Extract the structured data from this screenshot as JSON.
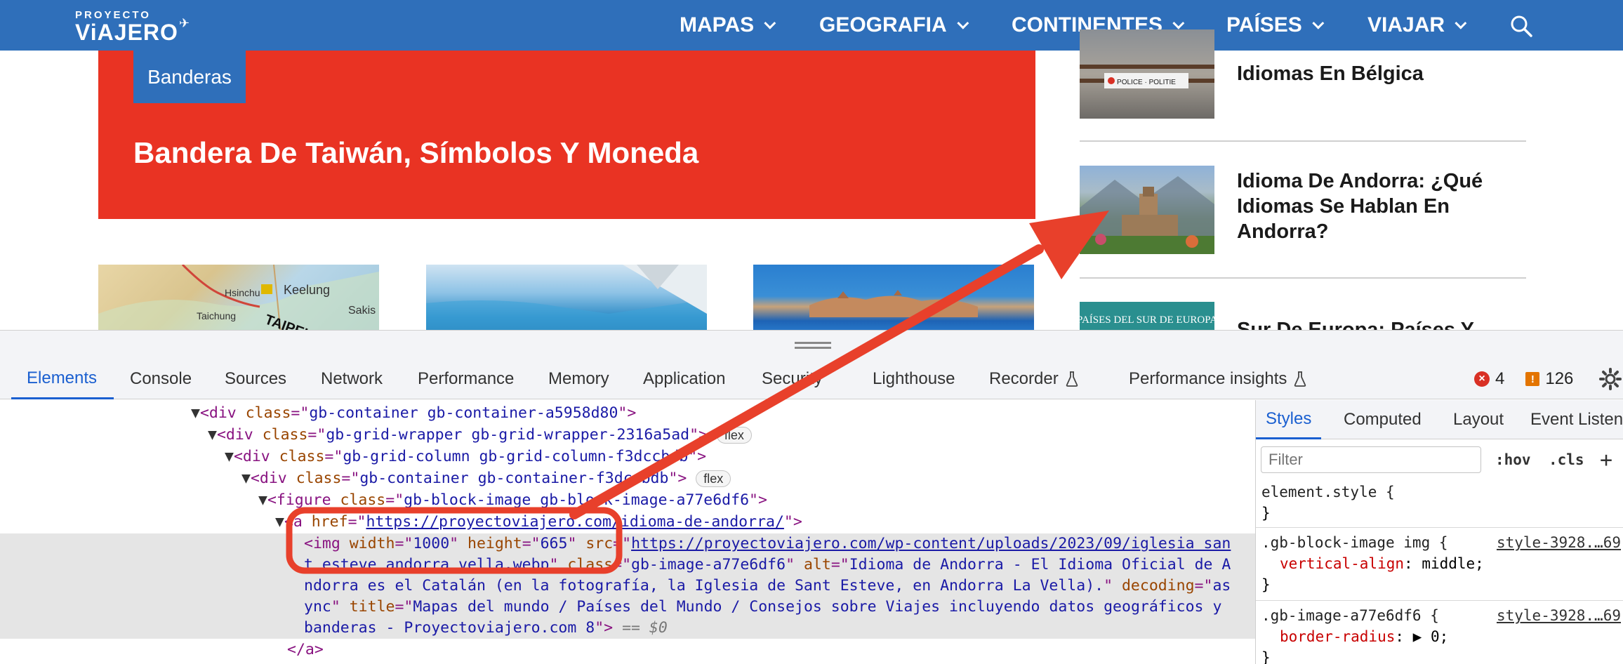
{
  "site": {
    "logo_line1": "PROYECTO",
    "logo_line2": "ViAJERO",
    "nav": [
      "MAPAS",
      "GEOGRAFIA",
      "CONTINENTES",
      "PAÍSES",
      "VIAJAR"
    ],
    "hero_badge": "Banderas",
    "hero_title": "Bandera De Taiwán, Símbolos Y Moneda",
    "thumb_map_text": [
      "Keelung",
      "TAIPEI",
      "Hsinchu",
      "Taichung",
      "Sakis"
    ],
    "sidebar": [
      {
        "title": "Idiomas En Bélgica",
        "img_text": "POLICE · POLITIE"
      },
      {
        "title": "Idioma De Andorra: ¿Qué Idiomas Se Hablan En Andorra?"
      },
      {
        "title": "Sur De Europa: Países Y",
        "img_text": "PAÍSES DEL SUR DE EUROPA"
      }
    ]
  },
  "devtools": {
    "tabs": [
      "Elements",
      "Console",
      "Sources",
      "Network",
      "Performance",
      "Memory",
      "Application",
      "Security",
      "Lighthouse",
      "Recorder",
      "Performance insights"
    ],
    "active_tab": "Elements",
    "error_count": "4",
    "warning_count": "126",
    "dom": {
      "l1_class": "gb-container gb-container-a5958d80",
      "l2_class": "gb-grid-wrapper gb-grid-wrapper-2316a5ad",
      "l2_badge": "flex",
      "l3_class": "gb-grid-column gb-grid-column-f3dccbdb",
      "l4_class": "gb-container gb-container-f3dccbdb",
      "l4_badge": "flex",
      "l5_class": "gb-block-image gb-block-image-a77e6df6",
      "l6_href": "https://proyectoviajero.com/idioma-de-andorra/",
      "img_width": "1000",
      "img_height": "665",
      "img_src": "https://proyectoviajero.com/wp-content/uploads/2023/09/iglesia san",
      "img_src_cont": "t esteve andorra vella.webp",
      "img_class": "gb-image-a77e6df6",
      "img_alt_1": "Idioma de Andorra - El Idioma Oficial de A",
      "img_alt_2": "ndorra es el Catalán (en la fotografía, la Iglesia de Sant Esteve, en Andorra La Vella).",
      "img_decoding_1": "as",
      "img_decoding_2": "ync",
      "img_title_1": "Mapas del mundo / Países del Mundo / Consejos sobre Viajes incluyendo datos geográficos y",
      "img_title_2": "banderas - Proyectoviajero.com 8",
      "selected_marker": "== $0",
      "close_tag": "</a>"
    },
    "styles": {
      "tabs": [
        "Styles",
        "Computed",
        "Layout",
        "Event Listen"
      ],
      "filter_placeholder": "Filter",
      "hov": ":hov",
      "cls": ".cls",
      "rules": [
        {
          "selector": "element.style {",
          "close": "}"
        },
        {
          "selector": ".gb-block-image img {",
          "prop": "vertical-align",
          "value": "middle;",
          "source": "style-3928.…69",
          "close": "}"
        },
        {
          "selector": ".gb-image-a77e6df6 {",
          "prop": "border-radius",
          "value": "▶ 0;",
          "source": "style-3928.…69",
          "close": "}"
        }
      ]
    }
  },
  "annotation": {
    "color": "#e8402b"
  }
}
